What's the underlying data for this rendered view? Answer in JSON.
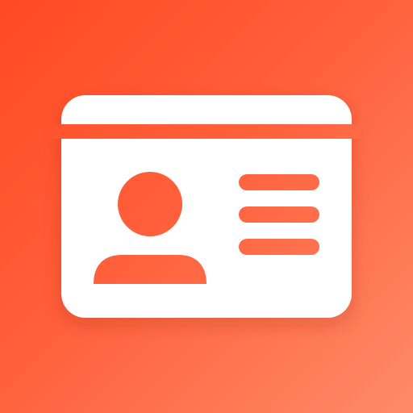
{
  "app_icon": {
    "icon": "id-card-icon",
    "background_colors": [
      "#FF4A24",
      "#FF5F3A",
      "#FF8A68"
    ],
    "card_color": "#FFFFFF",
    "cutout_color": "#FF6440"
  }
}
